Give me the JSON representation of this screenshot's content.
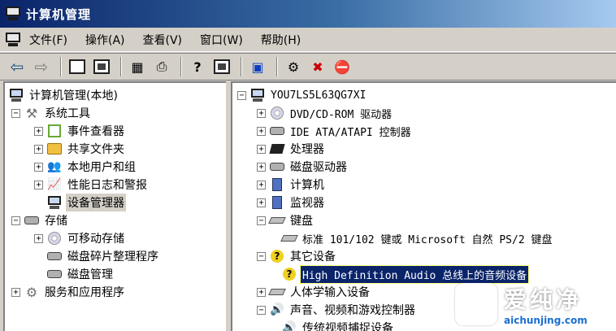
{
  "window": {
    "title": "计算机管理"
  },
  "menu": {
    "items": [
      "文件(F)",
      "操作(A)",
      "查看(V)",
      "窗口(W)",
      "帮助(H)"
    ]
  },
  "toolbar": {
    "icons": [
      "back-arrow-icon",
      "forward-arrow-icon",
      "up-folder-icon",
      "show-hide-tree-icon",
      "properties-icon",
      "print-icon",
      "help-icon",
      "export-icon",
      "scan-hardware-icon",
      "update-driver-icon",
      "uninstall-icon",
      "disable-icon"
    ]
  },
  "left_tree": {
    "root": "计算机管理(本地)",
    "items": [
      {
        "label": "系统工具"
      },
      {
        "label": "事件查看器"
      },
      {
        "label": "共享文件夹"
      },
      {
        "label": "本地用户和组"
      },
      {
        "label": "性能日志和警报"
      },
      {
        "label": "设备管理器"
      },
      {
        "label": "存储"
      },
      {
        "label": "可移动存储"
      },
      {
        "label": "磁盘碎片整理程序"
      },
      {
        "label": "磁盘管理"
      },
      {
        "label": "服务和应用程序"
      }
    ]
  },
  "right_tree": {
    "root": "YOU7LS5L63QG7XI",
    "items": [
      {
        "label": "DVD/CD-ROM 驱动器"
      },
      {
        "label": "IDE ATA/ATAPI 控制器"
      },
      {
        "label": "处理器"
      },
      {
        "label": "磁盘驱动器"
      },
      {
        "label": "计算机"
      },
      {
        "label": "监视器"
      },
      {
        "label": "键盘"
      },
      {
        "label": "标准 101/102 键或 Microsoft 自然 PS/2 键盘"
      },
      {
        "label": "其它设备"
      },
      {
        "label": "High Definition Audio 总线上的音频设备"
      },
      {
        "label": "人体学输入设备"
      },
      {
        "label": "声音、视频和游戏控制器"
      },
      {
        "label": "传统视频捕捉设备"
      }
    ]
  },
  "watermark": {
    "brand": "爱纯净",
    "url": "aichunjing.com"
  }
}
